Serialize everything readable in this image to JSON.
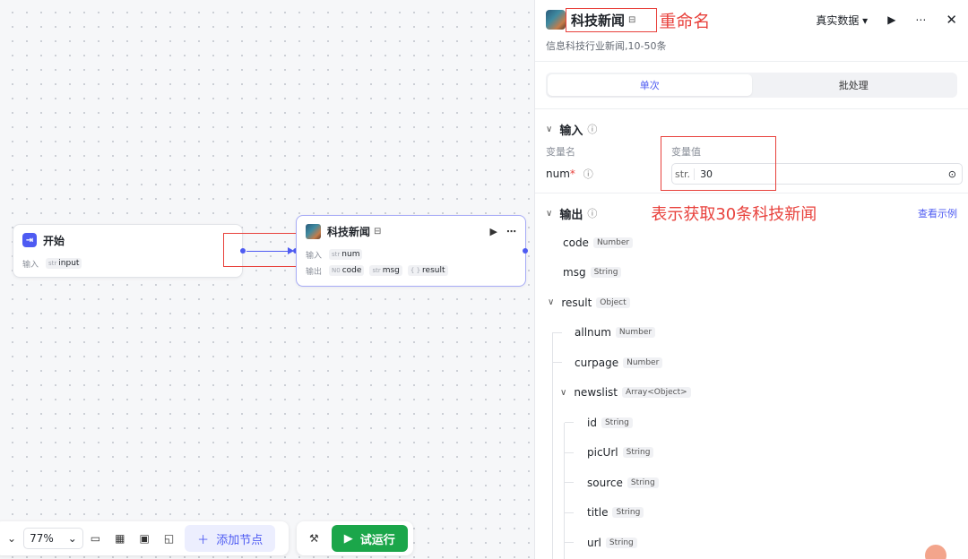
{
  "canvas": {
    "start_node": {
      "title": "开始",
      "input_label": "输入",
      "params": [
        {
          "type": "str",
          "name": "input"
        }
      ]
    },
    "news_node": {
      "title": "科技新闻",
      "input_label": "输入",
      "output_label": "输出",
      "inputs": [
        {
          "type": "str",
          "name": "num"
        }
      ],
      "outputs": [
        {
          "type": "N0",
          "name": "code"
        },
        {
          "type": "str",
          "name": "msg"
        },
        {
          "type": "{ }",
          "name": "result"
        }
      ]
    }
  },
  "toolbar": {
    "zoom": "77%",
    "add_node": "添加节点",
    "run": "试运行"
  },
  "panel": {
    "title": "科技新闻",
    "rename_annotation": "重命名",
    "data_mode": "真实数据 ▾",
    "description": "信息科技行业新闻,10-50条",
    "tabs": [
      "单次",
      "批处理"
    ],
    "input_section": {
      "title": "输入",
      "col_name": "变量名",
      "col_value": "变量值",
      "var_name": "num",
      "var_type": "str.",
      "var_value": "30",
      "annotation": "表示获取30条科技新闻"
    },
    "output_section": {
      "title": "输出",
      "view_example": "查看示例",
      "fields": [
        {
          "name": "code",
          "type": "Number"
        },
        {
          "name": "msg",
          "type": "String"
        },
        {
          "name": "result",
          "type": "Object"
        },
        {
          "name": "allnum",
          "type": "Number"
        },
        {
          "name": "curpage",
          "type": "Number"
        },
        {
          "name": "newslist",
          "type": "Array<Object>"
        },
        {
          "name": "id",
          "type": "String"
        },
        {
          "name": "picUrl",
          "type": "String"
        },
        {
          "name": "source",
          "type": "String"
        },
        {
          "name": "title",
          "type": "String"
        },
        {
          "name": "url",
          "type": "String"
        }
      ]
    }
  },
  "colors": {
    "accent": "#4e5bf2",
    "run_green": "#1ba64a",
    "annotation_red": "#e8413c"
  }
}
